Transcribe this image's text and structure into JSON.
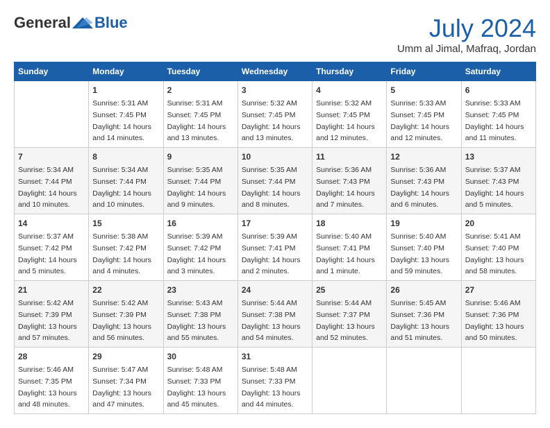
{
  "header": {
    "logo_general": "General",
    "logo_blue": "Blue",
    "month_year": "July 2024",
    "location": "Umm al Jimal, Mafraq, Jordan"
  },
  "days_of_week": [
    "Sunday",
    "Monday",
    "Tuesday",
    "Wednesday",
    "Thursday",
    "Friday",
    "Saturday"
  ],
  "weeks": [
    [
      {
        "day": "",
        "detail": ""
      },
      {
        "day": "1",
        "detail": "Sunrise: 5:31 AM\nSunset: 7:45 PM\nDaylight: 14 hours\nand 14 minutes."
      },
      {
        "day": "2",
        "detail": "Sunrise: 5:31 AM\nSunset: 7:45 PM\nDaylight: 14 hours\nand 13 minutes."
      },
      {
        "day": "3",
        "detail": "Sunrise: 5:32 AM\nSunset: 7:45 PM\nDaylight: 14 hours\nand 13 minutes."
      },
      {
        "day": "4",
        "detail": "Sunrise: 5:32 AM\nSunset: 7:45 PM\nDaylight: 14 hours\nand 12 minutes."
      },
      {
        "day": "5",
        "detail": "Sunrise: 5:33 AM\nSunset: 7:45 PM\nDaylight: 14 hours\nand 12 minutes."
      },
      {
        "day": "6",
        "detail": "Sunrise: 5:33 AM\nSunset: 7:45 PM\nDaylight: 14 hours\nand 11 minutes."
      }
    ],
    [
      {
        "day": "7",
        "detail": "Sunrise: 5:34 AM\nSunset: 7:44 PM\nDaylight: 14 hours\nand 10 minutes."
      },
      {
        "day": "8",
        "detail": "Sunrise: 5:34 AM\nSunset: 7:44 PM\nDaylight: 14 hours\nand 10 minutes."
      },
      {
        "day": "9",
        "detail": "Sunrise: 5:35 AM\nSunset: 7:44 PM\nDaylight: 14 hours\nand 9 minutes."
      },
      {
        "day": "10",
        "detail": "Sunrise: 5:35 AM\nSunset: 7:44 PM\nDaylight: 14 hours\nand 8 minutes."
      },
      {
        "day": "11",
        "detail": "Sunrise: 5:36 AM\nSunset: 7:43 PM\nDaylight: 14 hours\nand 7 minutes."
      },
      {
        "day": "12",
        "detail": "Sunrise: 5:36 AM\nSunset: 7:43 PM\nDaylight: 14 hours\nand 6 minutes."
      },
      {
        "day": "13",
        "detail": "Sunrise: 5:37 AM\nSunset: 7:43 PM\nDaylight: 14 hours\nand 5 minutes."
      }
    ],
    [
      {
        "day": "14",
        "detail": "Sunrise: 5:37 AM\nSunset: 7:42 PM\nDaylight: 14 hours\nand 5 minutes."
      },
      {
        "day": "15",
        "detail": "Sunrise: 5:38 AM\nSunset: 7:42 PM\nDaylight: 14 hours\nand 4 minutes."
      },
      {
        "day": "16",
        "detail": "Sunrise: 5:39 AM\nSunset: 7:42 PM\nDaylight: 14 hours\nand 3 minutes."
      },
      {
        "day": "17",
        "detail": "Sunrise: 5:39 AM\nSunset: 7:41 PM\nDaylight: 14 hours\nand 2 minutes."
      },
      {
        "day": "18",
        "detail": "Sunrise: 5:40 AM\nSunset: 7:41 PM\nDaylight: 14 hours\nand 1 minute."
      },
      {
        "day": "19",
        "detail": "Sunrise: 5:40 AM\nSunset: 7:40 PM\nDaylight: 13 hours\nand 59 minutes."
      },
      {
        "day": "20",
        "detail": "Sunrise: 5:41 AM\nSunset: 7:40 PM\nDaylight: 13 hours\nand 58 minutes."
      }
    ],
    [
      {
        "day": "21",
        "detail": "Sunrise: 5:42 AM\nSunset: 7:39 PM\nDaylight: 13 hours\nand 57 minutes."
      },
      {
        "day": "22",
        "detail": "Sunrise: 5:42 AM\nSunset: 7:39 PM\nDaylight: 13 hours\nand 56 minutes."
      },
      {
        "day": "23",
        "detail": "Sunrise: 5:43 AM\nSunset: 7:38 PM\nDaylight: 13 hours\nand 55 minutes."
      },
      {
        "day": "24",
        "detail": "Sunrise: 5:44 AM\nSunset: 7:38 PM\nDaylight: 13 hours\nand 54 minutes."
      },
      {
        "day": "25",
        "detail": "Sunrise: 5:44 AM\nSunset: 7:37 PM\nDaylight: 13 hours\nand 52 minutes."
      },
      {
        "day": "26",
        "detail": "Sunrise: 5:45 AM\nSunset: 7:36 PM\nDaylight: 13 hours\nand 51 minutes."
      },
      {
        "day": "27",
        "detail": "Sunrise: 5:46 AM\nSunset: 7:36 PM\nDaylight: 13 hours\nand 50 minutes."
      }
    ],
    [
      {
        "day": "28",
        "detail": "Sunrise: 5:46 AM\nSunset: 7:35 PM\nDaylight: 13 hours\nand 48 minutes."
      },
      {
        "day": "29",
        "detail": "Sunrise: 5:47 AM\nSunset: 7:34 PM\nDaylight: 13 hours\nand 47 minutes."
      },
      {
        "day": "30",
        "detail": "Sunrise: 5:48 AM\nSunset: 7:33 PM\nDaylight: 13 hours\nand 45 minutes."
      },
      {
        "day": "31",
        "detail": "Sunrise: 5:48 AM\nSunset: 7:33 PM\nDaylight: 13 hours\nand 44 minutes."
      },
      {
        "day": "",
        "detail": ""
      },
      {
        "day": "",
        "detail": ""
      },
      {
        "day": "",
        "detail": ""
      }
    ]
  ]
}
